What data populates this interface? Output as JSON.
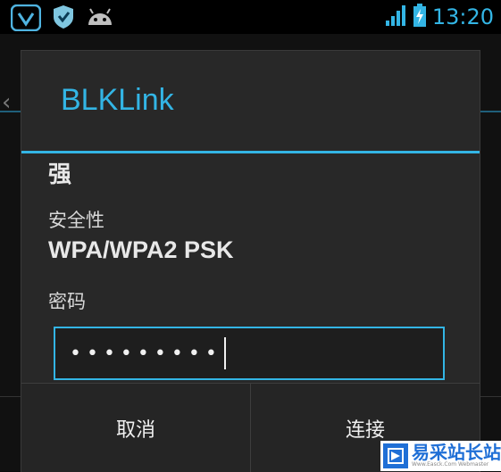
{
  "status_bar": {
    "time": "13:20",
    "icons": [
      "shield-badge-icon",
      "shield-check-icon",
      "android-icon",
      "signal-icon",
      "battery-charging-icon"
    ],
    "accent": "#33b5e5"
  },
  "dialog": {
    "title": "BLKLink",
    "signal_strength": "强",
    "security_label": "安全性",
    "security_value": "WPA/WPA2 PSK",
    "password_label": "密码",
    "password_value": "•••••••••",
    "cancel_label": "取消",
    "connect_label": "连接"
  },
  "watermark": {
    "title": "易采站长站",
    "subtitle": "Www.Easck.Com Webmaster"
  }
}
